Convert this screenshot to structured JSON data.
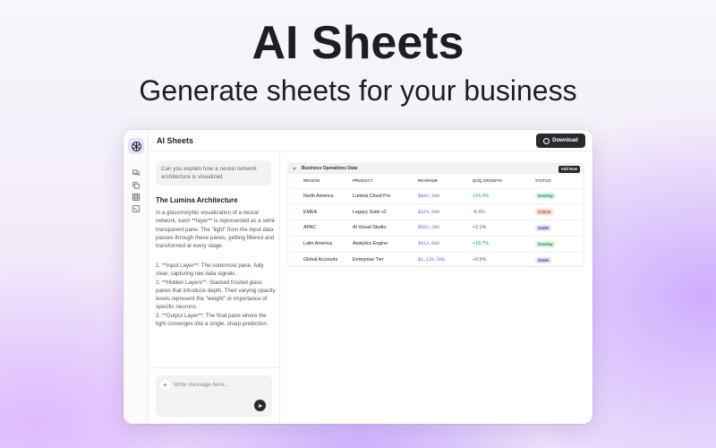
{
  "hero": {
    "title": "AI Sheets",
    "subtitle": "Generate sheets for your business"
  },
  "app": {
    "title": "AI Sheets",
    "download_label": "Download"
  },
  "rail": {
    "icons": [
      "chat-bubbles-icon",
      "copy-icon",
      "grid-icon",
      "terminal-icon"
    ]
  },
  "chat": {
    "user_question": "Can you explain how a neural network architecture is visualized",
    "answer_title": "The Lumina Architecture",
    "answer_paragraph": "In a glassmorphic visualization of a neural network, each **layer** is represented as a semi-transparent pane. The \"light\" from the input data passes through these panes, getting filtered and transformed at every stage.",
    "list": [
      "1. **Input Layer**: The outermost pane, fully clear, capturing raw data signals.",
      "2. **Hidden Layers**: Stacked frosted glass panes that introduce depth. Their varying opacity",
      "levels represent the \"weight\" or importance of specific neurons.",
      "3. **Output Layer**: The final pane where the light converges into a single, sharp prediction."
    ],
    "composer_placeholder": "Write message here..."
  },
  "sheet": {
    "title": "Business Operations Data",
    "add_row_label": "Add Row",
    "columns": [
      "REGION",
      "PRODUCT",
      "REVENUE",
      "QOQ GROWTH",
      "STATUS"
    ],
    "rows": [
      {
        "region": "North America",
        "product": "Lumina Cloud Pro",
        "revenue": "$842,390",
        "growth": "+14.2%",
        "status": "Growing",
        "trend": "up"
      },
      {
        "region": "EMEA",
        "product": "Legacy Suite v2",
        "revenue": "$124,500",
        "growth": "-8.4%",
        "status": "Critical",
        "trend": "down"
      },
      {
        "region": "APAC",
        "product": "AI Visual Studio",
        "revenue": "$562,300",
        "growth": "+2.1%",
        "status": "Stable",
        "trend": "flat"
      },
      {
        "region": "Latin America",
        "product": "Analytics Engine",
        "revenue": "$312,000",
        "growth": "+18.7%",
        "status": "Growing",
        "trend": "up"
      },
      {
        "region": "Global Accounts",
        "product": "Enterprise Tier",
        "revenue": "$1,120,500",
        "growth": "+0.5%",
        "status": "Stable",
        "trend": "flat"
      }
    ]
  },
  "colors": {
    "accent": "#6b5bd6",
    "dark_button": "#2a2a2e",
    "growing": "#1d8a4a",
    "critical": "#c23a30",
    "stable": "#3c4f7c"
  }
}
